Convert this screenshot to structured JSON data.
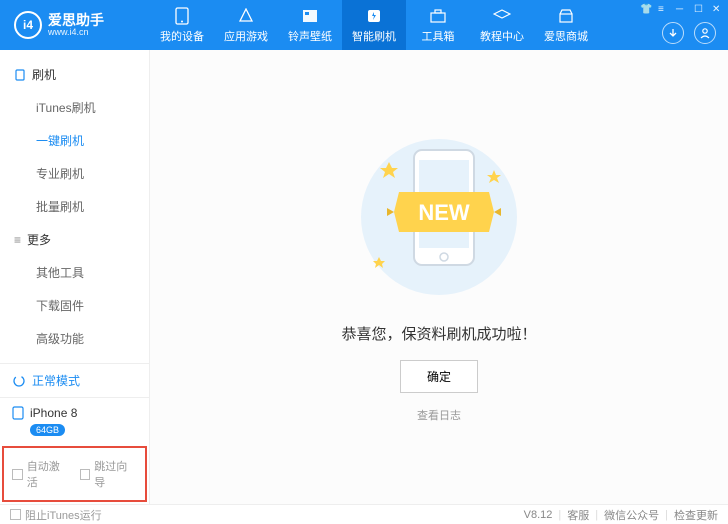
{
  "logo": {
    "badge": "i4",
    "title": "爱思助手",
    "sub": "www.i4.cn"
  },
  "nav": [
    {
      "icon": "phone",
      "label": "我的设备"
    },
    {
      "icon": "apps",
      "label": "应用游戏"
    },
    {
      "icon": "ring",
      "label": "铃声壁纸"
    },
    {
      "icon": "flash",
      "label": "智能刷机",
      "active": true
    },
    {
      "icon": "tool",
      "label": "工具箱"
    },
    {
      "icon": "help",
      "label": "教程中心"
    },
    {
      "icon": "shop",
      "label": "爱思商城"
    }
  ],
  "sidebar": {
    "group1": "刷机",
    "items1": [
      "iTunes刷机",
      "一键刷机",
      "专业刷机",
      "批量刷机"
    ],
    "group2": "更多",
    "items2": [
      "其他工具",
      "下载固件",
      "高级功能"
    ],
    "status": "正常模式",
    "device": "iPhone 8",
    "storage": "64GB",
    "chk1": "自动激活",
    "chk2": "跳过向导"
  },
  "main": {
    "message": "恭喜您，保资料刷机成功啦！",
    "button": "确定",
    "log": "查看日志",
    "new": "NEW"
  },
  "footer": {
    "left": "阻止iTunes运行",
    "version": "V8.12",
    "r1": "客服",
    "r2": "微信公众号",
    "r3": "检查更新"
  }
}
